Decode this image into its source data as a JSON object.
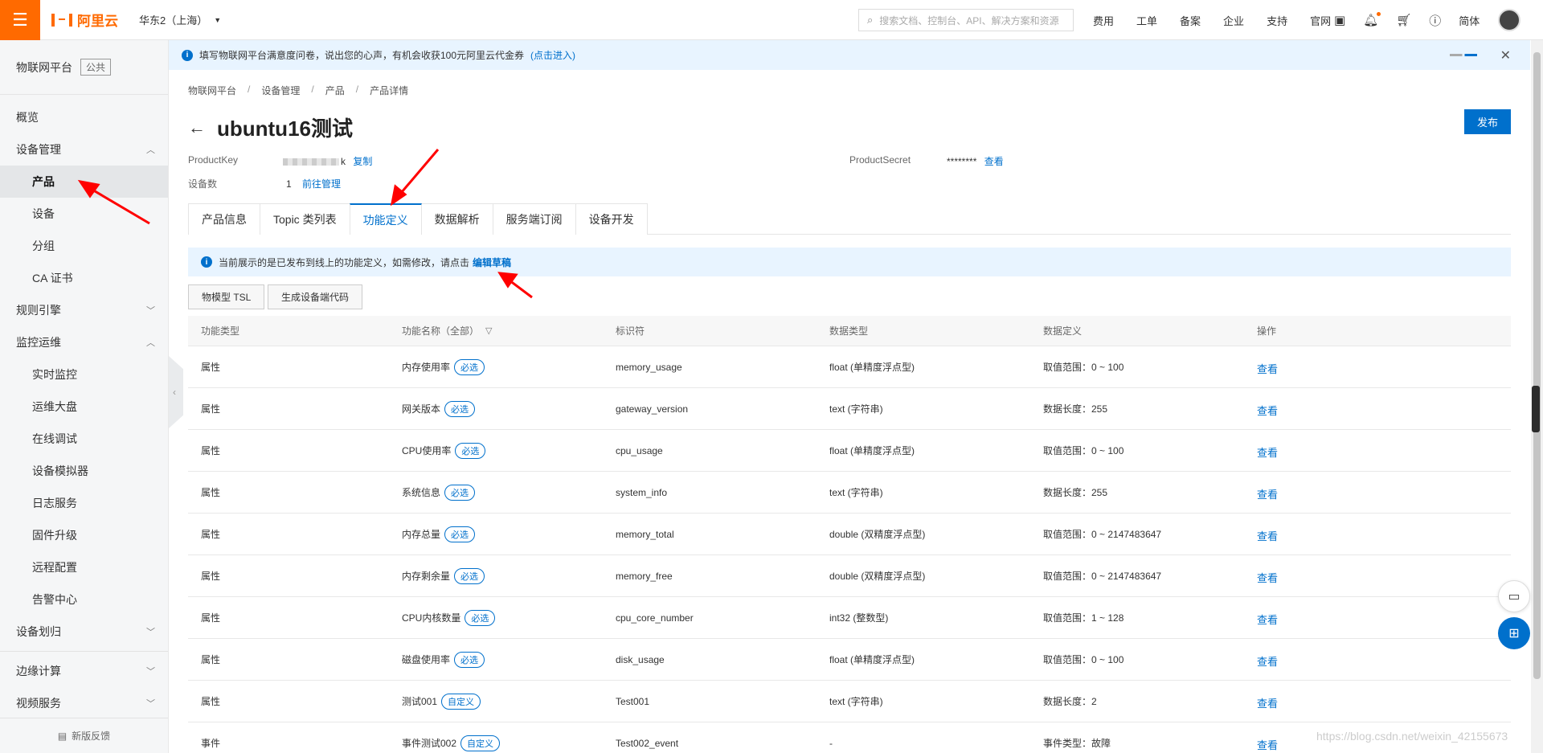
{
  "topbar": {
    "logo": "阿里云",
    "region": "华东2（上海）",
    "search_placeholder": "搜索文档、控制台、API、解决方案和资源",
    "nav": [
      "费用",
      "工单",
      "备案",
      "企业",
      "支持",
      "官网"
    ],
    "lang": "简体"
  },
  "sidebar": {
    "title": "物联网平台",
    "tag": "公共",
    "items": [
      {
        "label": "概览"
      },
      {
        "label": "设备管理"
      },
      {
        "label": "产品"
      },
      {
        "label": "设备"
      },
      {
        "label": "分组"
      },
      {
        "label": "CA 证书"
      },
      {
        "label": "规则引擎"
      },
      {
        "label": "监控运维"
      },
      {
        "label": "实时监控"
      },
      {
        "label": "运维大盘"
      },
      {
        "label": "在线调试"
      },
      {
        "label": "设备模拟器"
      },
      {
        "label": "日志服务"
      },
      {
        "label": "固件升级"
      },
      {
        "label": "远程配置"
      },
      {
        "label": "告警中心"
      },
      {
        "label": "设备划归"
      },
      {
        "label": "边缘计算"
      },
      {
        "label": "视频服务"
      }
    ],
    "feedback": "新版反馈"
  },
  "notice": {
    "text": "填写物联网平台满意度问卷，说出您的心声，有机会收获100元阿里云代金券",
    "link": "(点击进入)"
  },
  "breadcrumb": [
    "物联网平台",
    "设备管理",
    "产品",
    "产品详情"
  ],
  "page": {
    "title": "ubuntu16测试",
    "publish": "发布",
    "product_key_label": "ProductKey",
    "product_key_suffix": "k",
    "copy": "复制",
    "device_count_label": "设备数",
    "device_count": "1",
    "manage_link": "前往管理",
    "product_secret_label": "ProductSecret",
    "product_secret_value": "********",
    "view": "查看"
  },
  "tabs": [
    "产品信息",
    "Topic 类列表",
    "功能定义",
    "数据解析",
    "服务端订阅",
    "设备开发"
  ],
  "info_bar": {
    "text": "当前展示的是已发布到线上的功能定义，如需修改，请点击",
    "link": "编辑草稿"
  },
  "buttons": {
    "tsl": "物模型 TSL",
    "gen_code": "生成设备端代码"
  },
  "table": {
    "headers": [
      "功能类型",
      "功能名称（全部）",
      "标识符",
      "数据类型",
      "数据定义",
      "操作"
    ],
    "rows": [
      {
        "type": "属性",
        "name": "内存使用率",
        "badge": "必选",
        "id": "memory_usage",
        "dtype": "float (单精度浮点型)",
        "def": "取值范围：0 ~ 100",
        "op": "查看"
      },
      {
        "type": "属性",
        "name": "网关版本",
        "badge": "必选",
        "id": "gateway_version",
        "dtype": "text (字符串)",
        "def": "数据长度：255",
        "op": "查看"
      },
      {
        "type": "属性",
        "name": "CPU使用率",
        "badge": "必选",
        "id": "cpu_usage",
        "dtype": "float (单精度浮点型)",
        "def": "取值范围：0 ~ 100",
        "op": "查看"
      },
      {
        "type": "属性",
        "name": "系统信息",
        "badge": "必选",
        "id": "system_info",
        "dtype": "text (字符串)",
        "def": "数据长度：255",
        "op": "查看"
      },
      {
        "type": "属性",
        "name": "内存总量",
        "badge": "必选",
        "id": "memory_total",
        "dtype": "double (双精度浮点型)",
        "def": "取值范围：0 ~ 2147483647",
        "op": "查看"
      },
      {
        "type": "属性",
        "name": "内存剩余量",
        "badge": "必选",
        "id": "memory_free",
        "dtype": "double (双精度浮点型)",
        "def": "取值范围：0 ~ 2147483647",
        "op": "查看"
      },
      {
        "type": "属性",
        "name": "CPU内核数量",
        "badge": "必选",
        "id": "cpu_core_number",
        "dtype": "int32 (整数型)",
        "def": "取值范围：1 ~ 128",
        "op": "查看"
      },
      {
        "type": "属性",
        "name": "磁盘使用率",
        "badge": "必选",
        "id": "disk_usage",
        "dtype": "float (单精度浮点型)",
        "def": "取值范围：0 ~ 100",
        "op": "查看"
      },
      {
        "type": "属性",
        "name": "测试001",
        "badge": "自定义",
        "id": "Test001",
        "dtype": "text (字符串)",
        "def": "数据长度：2",
        "op": "查看"
      },
      {
        "type": "事件",
        "name": "事件测试002",
        "badge": "自定义",
        "id": "Test002_event",
        "dtype": "-",
        "def": "事件类型：故障",
        "op": "查看"
      }
    ]
  },
  "watermark": "https://blog.csdn.net/weixin_42155673",
  "colors": {
    "brand": "#ff6a00",
    "link": "#0070cc",
    "annotation_arrow": "#ff0000"
  }
}
